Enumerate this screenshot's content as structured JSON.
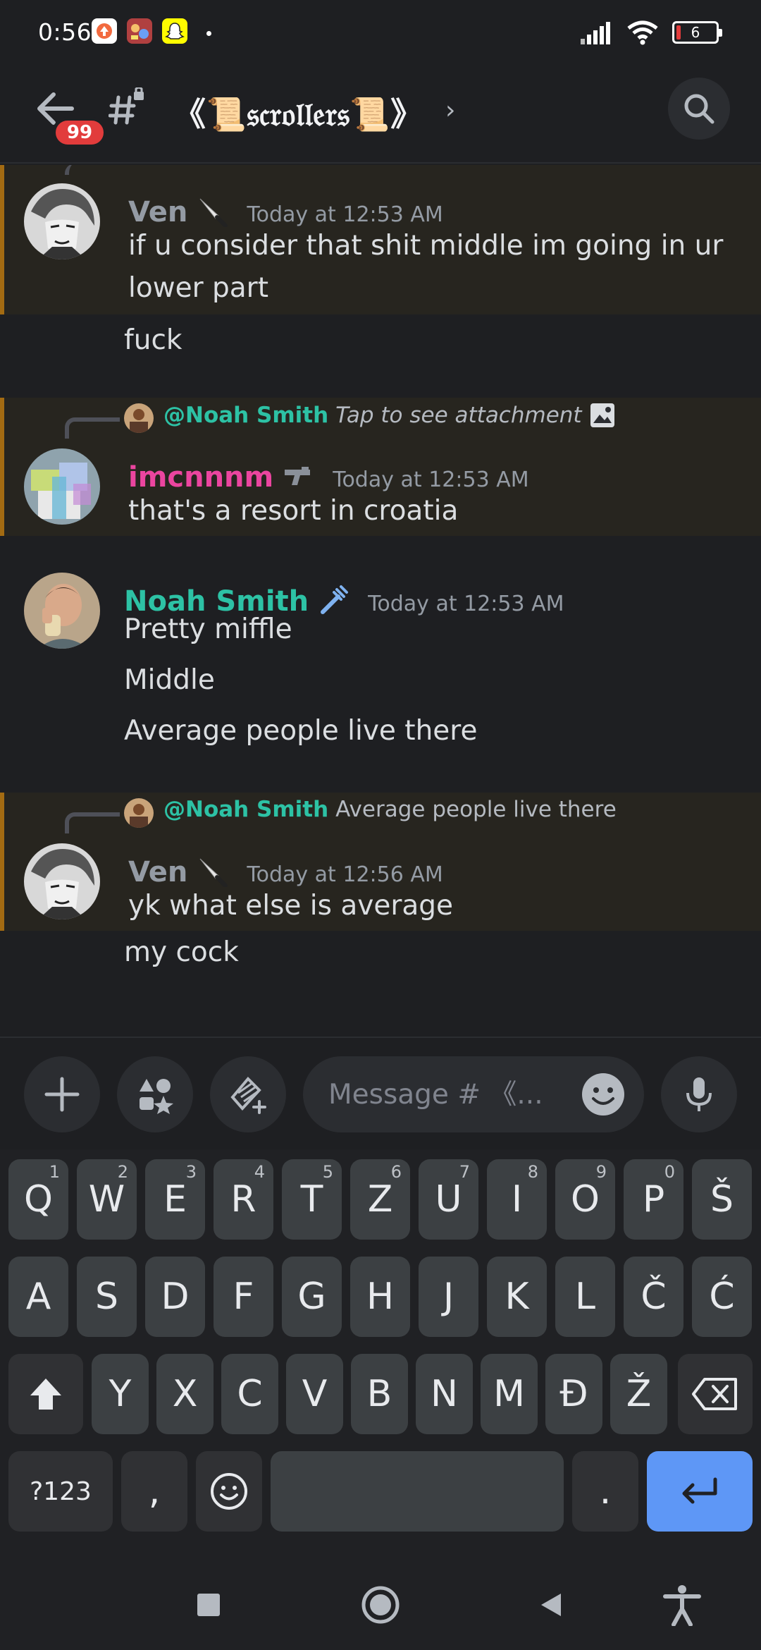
{
  "status_bar": {
    "time": "0:56",
    "battery": "6"
  },
  "header": {
    "unread_badge": "99",
    "channel_name": "《📜𝔰𝔠𝔯𝔬𝔩𝔩𝔢𝔯𝔰📜》",
    "chevron": "›"
  },
  "messages": [
    {
      "author": "Ven",
      "author_color": "#949ba4",
      "time": "Today at 12:53 AM",
      "lines": [
        "if u consider that shit middle im going in ur",
        "lower part",
        "fuck"
      ],
      "highlighted": true
    },
    {
      "reply_to": "@Noah Smith",
      "reply_text": "Tap to see attachment",
      "author": "imcnnnm",
      "author_color": "#eb459f",
      "time": "Today at 12:53 AM",
      "lines": [
        "that's a resort in croatia"
      ],
      "highlighted": true
    },
    {
      "author": "Noah Smith",
      "author_color": "#2dc2a5",
      "time": "Today at 12:53 AM",
      "lines": [
        "Pretty miffle",
        "Middle",
        "Average people live there"
      ],
      "highlighted": false
    },
    {
      "reply_to": "@Noah Smith",
      "reply_text": "Average people live there",
      "author": "Ven",
      "author_color": "#949ba4",
      "time": "Today at 12:56 AM",
      "lines": [
        "yk what else is average",
        "my cock"
      ],
      "highlighted": true
    }
  ],
  "input": {
    "placeholder": "Message # 《..."
  },
  "keyboard": {
    "row1": [
      "Q",
      "W",
      "E",
      "R",
      "T",
      "Z",
      "U",
      "I",
      "O",
      "P",
      "Š"
    ],
    "row1_hints": [
      "1",
      "2",
      "3",
      "4",
      "5",
      "6",
      "7",
      "8",
      "9",
      "0",
      ""
    ],
    "row2": [
      "A",
      "S",
      "D",
      "F",
      "G",
      "H",
      "J",
      "K",
      "L",
      "Č",
      "Ć"
    ],
    "row3": [
      "Y",
      "X",
      "C",
      "V",
      "B",
      "N",
      "M",
      "Đ",
      "Ž"
    ],
    "symbols_label": "?123",
    "comma_label": ",",
    "period_label": "."
  },
  "colors": {
    "accent": "#5e97f6",
    "badge": "#e23c3c",
    "mention_bar": "#a36b12"
  }
}
